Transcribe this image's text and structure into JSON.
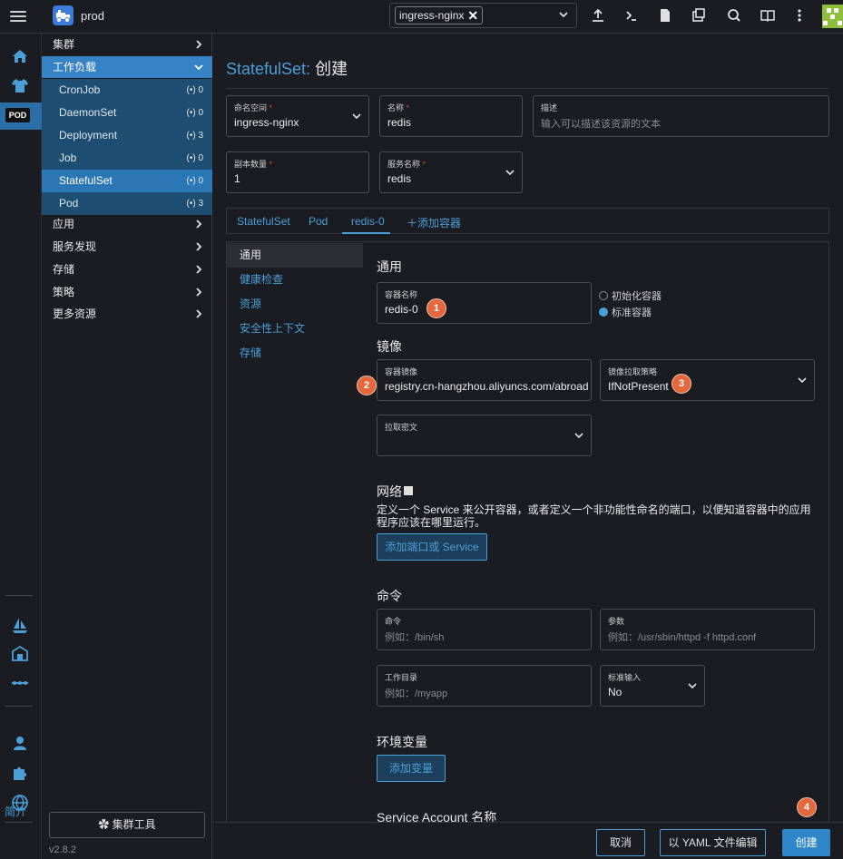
{
  "top": {
    "cluster_name": "prod",
    "namespace_chip": "ingress-nginx"
  },
  "rail": {
    "pod_badge": "POD",
    "about": "简介"
  },
  "nav": {
    "groups": {
      "cluster": "集群",
      "workload": "工作负载",
      "apps": "应用",
      "service_discovery": "服务发现",
      "storage": "存储",
      "policy": "策略",
      "more": "更多资源"
    },
    "workloads": [
      {
        "label": "CronJob",
        "count": "0"
      },
      {
        "label": "DaemonSet",
        "count": "0"
      },
      {
        "label": "Deployment",
        "count": "3"
      },
      {
        "label": "Job",
        "count": "0"
      },
      {
        "label": "StatefulSet",
        "count": "0"
      },
      {
        "label": "Pod",
        "count": "3"
      }
    ],
    "cluster_tools": "集群工具",
    "version": "v2.8.2"
  },
  "page": {
    "kind": "StatefulSet:",
    "action": "创建"
  },
  "form": {
    "namespace": {
      "label": "命名空间",
      "value": "ingress-nginx"
    },
    "name": {
      "label": "名称",
      "value": "redis"
    },
    "description": {
      "label": "描述",
      "placeholder": "输入可以描述该资源的文本"
    },
    "replicas": {
      "label": "副本数量",
      "value": "1"
    },
    "service_name": {
      "label": "服务名称",
      "value": "redis"
    }
  },
  "tabs": {
    "statefulset": "StatefulSet",
    "pod": "Pod",
    "container": "redis-0",
    "add_container": "添加容器"
  },
  "side_tabs": [
    "通用",
    "健康检查",
    "资源",
    "安全性上下文",
    "存储"
  ],
  "container": {
    "general_title": "通用",
    "container_name": {
      "label": "容器名称",
      "value": "redis-0"
    },
    "init_container": "初始化容器",
    "standard_container": "标准容器",
    "image_title": "镜像",
    "image": {
      "label": "容器镜像",
      "value": "registry.cn-hangzhou.aliyuncs.com/abroad_imag"
    },
    "pull_policy": {
      "label": "镜像拉取策略",
      "value": "IfNotPresent"
    },
    "pull_secret": {
      "label": "拉取密文"
    },
    "network_title": "网络",
    "network_desc": "定义一个 Service 来公开容器，或者定义一个非功能性命名的端口，以便知道容器中的应用程序应该在哪里运行。",
    "add_port": "添加端口或 Service",
    "command_title": "命令",
    "command": {
      "label": "命令",
      "placeholder": "例如：/bin/sh"
    },
    "args": {
      "label": "参数",
      "placeholder": "例如：/usr/sbin/httpd -f httpd.conf"
    },
    "workdir": {
      "label": "工作目录",
      "placeholder": "例如：/myapp"
    },
    "stdin": {
      "label": "标准输入",
      "value": "No"
    },
    "env_title": "环境变量",
    "add_env": "添加变量",
    "sa_title": "Service Account 名称"
  },
  "markers": [
    "1",
    "2",
    "3",
    "4"
  ],
  "footer": {
    "cancel": "取消",
    "edit_yaml": "以 YAML 文件编辑",
    "create": "创建"
  },
  "colors": {
    "accent": "#4a9fd8",
    "nav_active": "#3582c4",
    "marker": "#e5683d"
  }
}
